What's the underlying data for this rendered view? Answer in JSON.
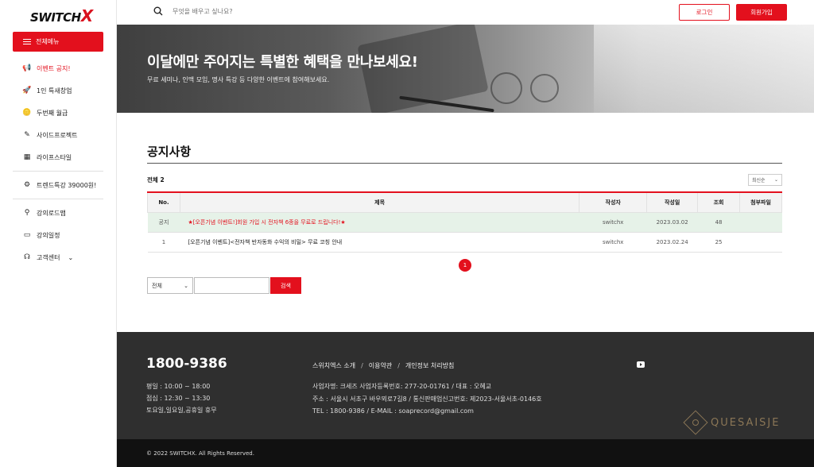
{
  "brand": {
    "logo_text": "SWITCH",
    "logo_x": "X"
  },
  "sidebar": {
    "menu_button": "전체메뉴",
    "items": [
      {
        "label": "이벤트 공지!",
        "icon": "megaphone-icon",
        "glyph": "📢"
      },
      {
        "label": "1인 특새창업",
        "icon": "rocket-icon",
        "glyph": "🚀"
      },
      {
        "label": "두번째 월급",
        "icon": "coin-icon",
        "glyph": "🪙"
      },
      {
        "label": "사이드프로젝트",
        "icon": "puzzle-icon",
        "glyph": "✎"
      },
      {
        "label": "라이프스타일",
        "icon": "qr-icon",
        "glyph": "▦"
      },
      {
        "label": "트렌드특강 39000원!",
        "icon": "gear-icon",
        "glyph": "⚙"
      },
      {
        "label": "강의로드맵",
        "icon": "roadmap-icon",
        "glyph": "⚲"
      },
      {
        "label": "강의일정",
        "icon": "calendar-icon",
        "glyph": "▭"
      },
      {
        "label": "고객센터",
        "icon": "headset-icon",
        "glyph": "☊"
      }
    ]
  },
  "header": {
    "search_placeholder": "무엇을 배우고 싶나요?",
    "login": "로그인",
    "signup": "회원가입"
  },
  "banner": {
    "title": "이달에만 주어지는 특별한 혜택을 만나보세요!",
    "subtitle": "무료 세미나, 인맥 모임, 명사 특강 등 다양한 이벤트에 참여해보세요."
  },
  "board": {
    "title": "공지사항",
    "total_label": "전체",
    "total_count": "2",
    "sort": "최신순",
    "columns": [
      "No.",
      "제목",
      "작성자",
      "작성일",
      "조회",
      "첨부파일"
    ],
    "rows": [
      {
        "no": "공지",
        "title": "★[오픈기념 이벤트!]회원 가입 시 전자책 6종을 무료로 드립니다!★",
        "author": "switchx",
        "date": "2023.03.02",
        "views": "48",
        "file": ""
      },
      {
        "no": "1",
        "title": "[오픈기념 이벤트]<전자책 반자동화 수익의 비밀> 무료 코칭 안내",
        "author": "switchx",
        "date": "2023.02.24",
        "views": "25",
        "file": ""
      }
    ],
    "page": "1",
    "search_scope": "전체",
    "search_button": "검색"
  },
  "footer": {
    "phone": "1800-9386",
    "hours": [
      "평일 : 10:00 ~ 18:00",
      "점심 : 12:30 ~ 13:30",
      "토요일,일요일,공휴일 휴무"
    ],
    "links": [
      "스위치엑스 소개",
      "이용약관",
      "개인정보 처리방침"
    ],
    "info": [
      "사업자명: 크세즈 사업자등록번호: 277-20-01761 / 대표 : 오혜교",
      "주소 : 서울시 서초구 바우뫼로7길8 / 통신판매업신고번호: 제2023-서울서초-0146호",
      "TEL : 1800-9386 / E-MAIL : soaprecord@gmail.com"
    ],
    "brand_name": "QUESAISJE",
    "copyright": "© 2022 SWITCHX. All Rights Reserved."
  },
  "colors": {
    "accent": "#e3101d",
    "footer_bg": "#2f2f2f",
    "copyright_bg": "#111111",
    "notice_row": "#e6f2e8"
  }
}
